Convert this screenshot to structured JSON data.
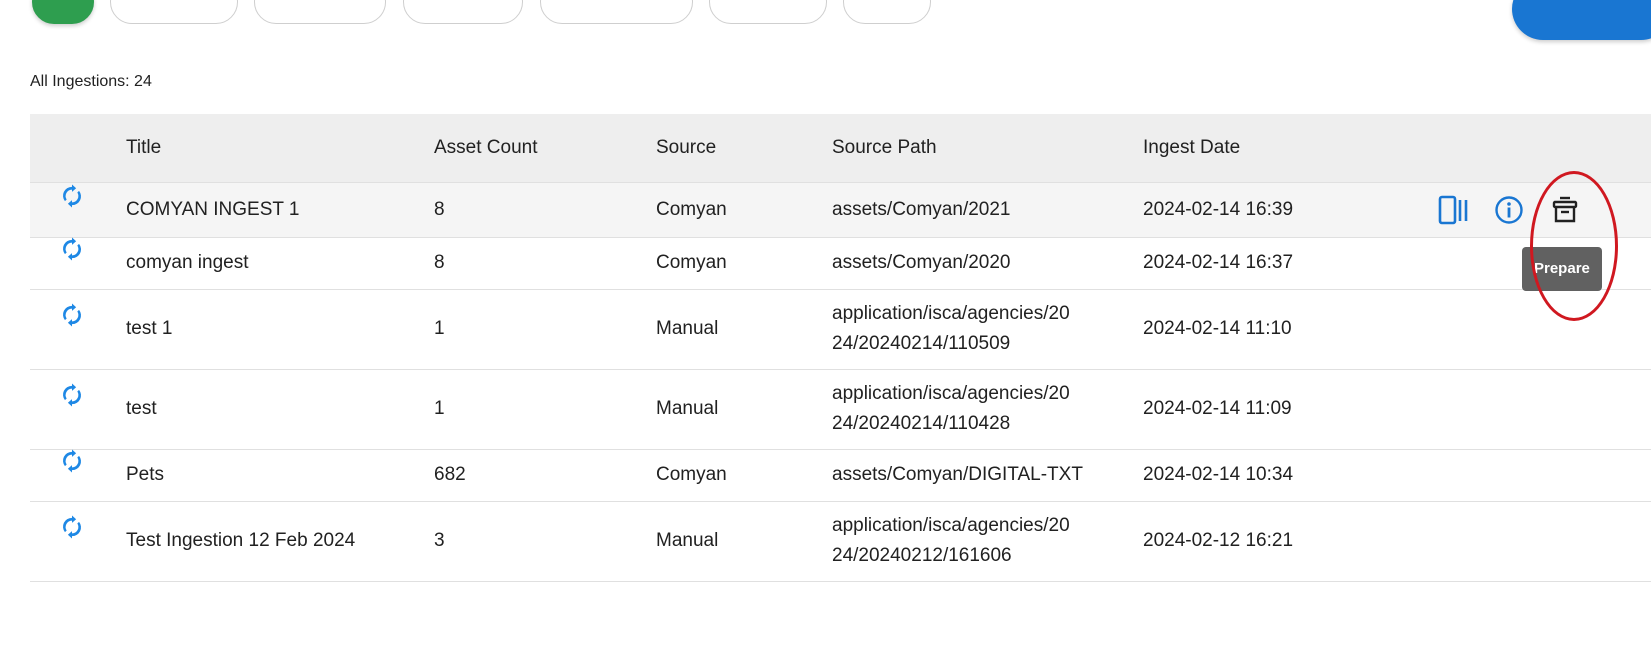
{
  "count_label": "All Ingestions: 24",
  "colors": {
    "accent": "#1976d2",
    "sync_icon": "#1e88e5",
    "header_bg": "#eeeeee",
    "tooltip_bg": "#616161",
    "annotation": "#d01820",
    "green_chip": "#2e9e4f"
  },
  "table": {
    "headers": {
      "title": "Title",
      "asset_count": "Asset Count",
      "source": "Source",
      "source_path": "Source Path",
      "ingest_date": "Ingest Date"
    },
    "rows": [
      {
        "title": "COMYAN INGEST 1",
        "asset_count": "8",
        "source": "Comyan",
        "source_path": "assets/Comyan/2021",
        "ingest_date": "2024-02-14 16:39"
      },
      {
        "title": "comyan ingest",
        "asset_count": "8",
        "source": "Comyan",
        "source_path": "assets/Comyan/2020",
        "ingest_date": "2024-02-14 16:37"
      },
      {
        "title": "test 1",
        "asset_count": "1",
        "source": "Manual",
        "source_path": "application/isca/agencies/20\n24/20240214/110509",
        "ingest_date": "2024-02-14 11:10"
      },
      {
        "title": "test",
        "asset_count": "1",
        "source": "Manual",
        "source_path": "application/isca/agencies/20\n24/20240214/110428",
        "ingest_date": "2024-02-14 11:09"
      },
      {
        "title": "Pets",
        "asset_count": "682",
        "source": "Comyan",
        "source_path": "assets/Comyan/DIGITAL-TXT",
        "ingest_date": "2024-02-14 10:34"
      },
      {
        "title": "Test Ingestion 12 Feb 2024",
        "asset_count": "3",
        "source": "Manual",
        "source_path": "application/isca/agencies/20\n24/20240212/161606",
        "ingest_date": "2024-02-12 16:21"
      }
    ],
    "row_icon": "sync-icon",
    "hover_actions": {
      "icons": [
        "view-panel-icon",
        "info-icon",
        "prepare-archive-icon"
      ],
      "tooltip": "Prepare"
    }
  }
}
